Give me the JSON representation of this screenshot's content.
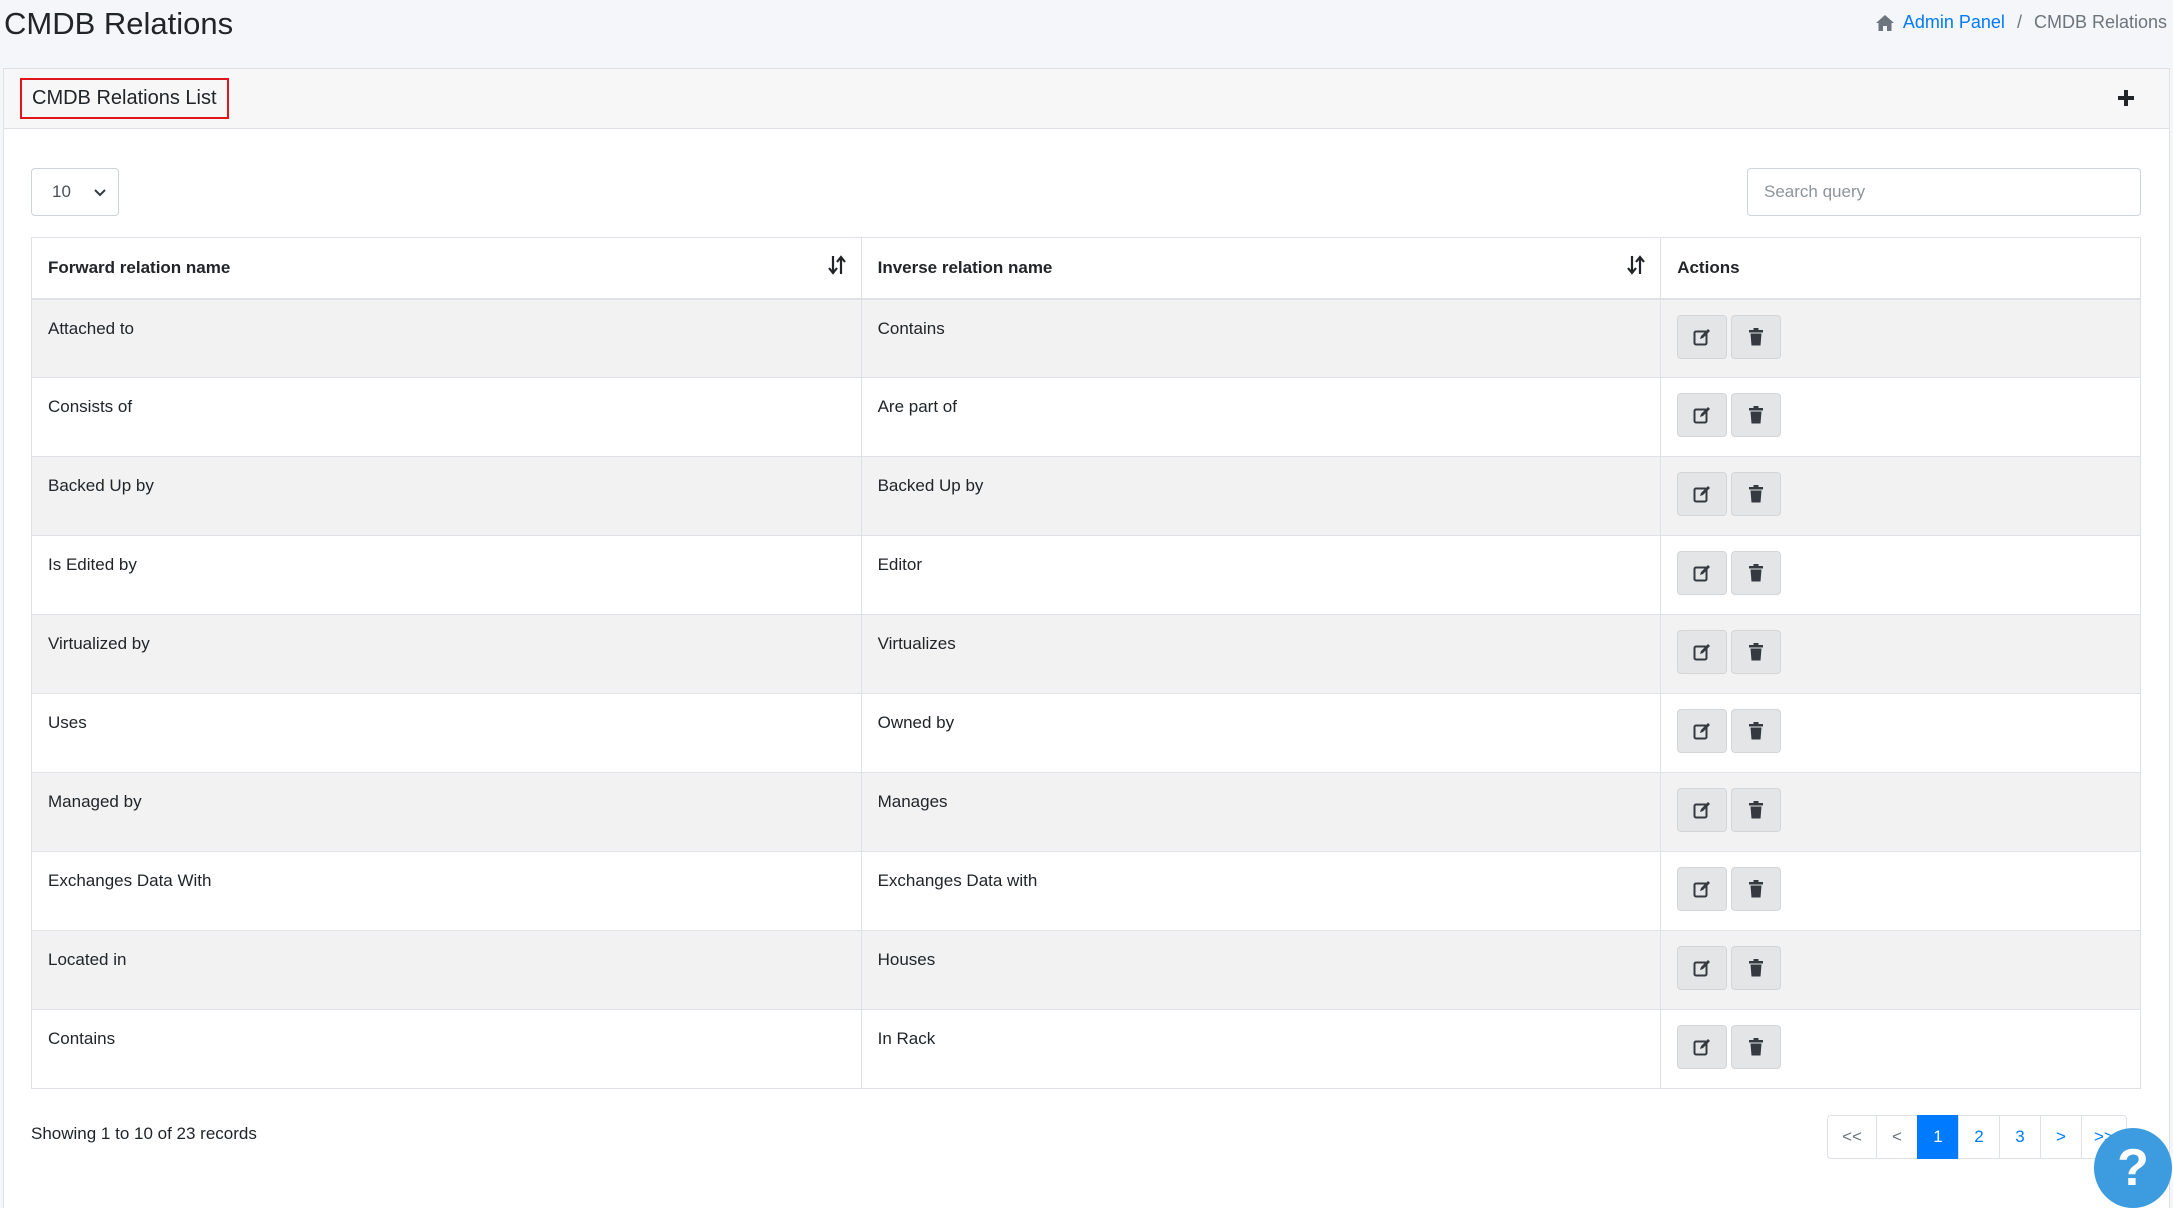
{
  "page": {
    "title": "CMDB Relations"
  },
  "breadcrumb": {
    "home_label": "Admin Panel",
    "separator": "/",
    "current": "CMDB Relations"
  },
  "card": {
    "title": "CMDB Relations List"
  },
  "controls": {
    "page_length": "10",
    "search_placeholder": "Search query"
  },
  "table": {
    "headers": {
      "forward": "Forward relation name",
      "inverse": "Inverse relation name",
      "actions": "Actions"
    },
    "rows": [
      {
        "forward": "Attached to",
        "inverse": "Contains"
      },
      {
        "forward": "Consists of",
        "inverse": "Are part of"
      },
      {
        "forward": "Backed Up by",
        "inverse": "Backed Up by"
      },
      {
        "forward": "Is Edited by",
        "inverse": "Editor"
      },
      {
        "forward": "Virtualized by",
        "inverse": "Virtualizes"
      },
      {
        "forward": "Uses",
        "inverse": "Owned by"
      },
      {
        "forward": "Managed by",
        "inverse": "Manages"
      },
      {
        "forward": "Exchanges Data With",
        "inverse": "Exchanges Data with"
      },
      {
        "forward": "Located in",
        "inverse": "Houses"
      },
      {
        "forward": "Contains",
        "inverse": "In Rack"
      }
    ]
  },
  "footer": {
    "info": "Showing 1 to 10 of 23 records",
    "pagination": {
      "first": "<<",
      "prev": "<",
      "pages": [
        "1",
        "2",
        "3"
      ],
      "next": ">",
      "last": ">>",
      "current": "1"
    }
  },
  "help": {
    "label": "?"
  },
  "colors": {
    "accent": "#007bff",
    "highlight_border": "#e0161d",
    "help_button": "#3d9be0"
  }
}
